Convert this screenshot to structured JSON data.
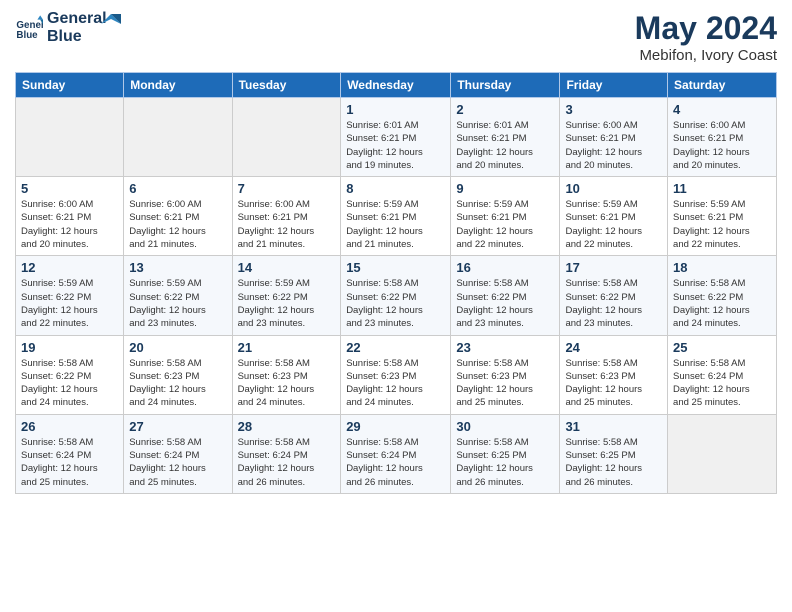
{
  "logo": {
    "line1": "General",
    "line2": "Blue"
  },
  "title": "May 2024",
  "subtitle": "Mebifon, Ivory Coast",
  "weekdays": [
    "Sunday",
    "Monday",
    "Tuesday",
    "Wednesday",
    "Thursday",
    "Friday",
    "Saturday"
  ],
  "weeks": [
    [
      {
        "day": "",
        "info": ""
      },
      {
        "day": "",
        "info": ""
      },
      {
        "day": "",
        "info": ""
      },
      {
        "day": "1",
        "info": "Sunrise: 6:01 AM\nSunset: 6:21 PM\nDaylight: 12 hours\nand 19 minutes."
      },
      {
        "day": "2",
        "info": "Sunrise: 6:01 AM\nSunset: 6:21 PM\nDaylight: 12 hours\nand 20 minutes."
      },
      {
        "day": "3",
        "info": "Sunrise: 6:00 AM\nSunset: 6:21 PM\nDaylight: 12 hours\nand 20 minutes."
      },
      {
        "day": "4",
        "info": "Sunrise: 6:00 AM\nSunset: 6:21 PM\nDaylight: 12 hours\nand 20 minutes."
      }
    ],
    [
      {
        "day": "5",
        "info": "Sunrise: 6:00 AM\nSunset: 6:21 PM\nDaylight: 12 hours\nand 20 minutes."
      },
      {
        "day": "6",
        "info": "Sunrise: 6:00 AM\nSunset: 6:21 PM\nDaylight: 12 hours\nand 21 minutes."
      },
      {
        "day": "7",
        "info": "Sunrise: 6:00 AM\nSunset: 6:21 PM\nDaylight: 12 hours\nand 21 minutes."
      },
      {
        "day": "8",
        "info": "Sunrise: 5:59 AM\nSunset: 6:21 PM\nDaylight: 12 hours\nand 21 minutes."
      },
      {
        "day": "9",
        "info": "Sunrise: 5:59 AM\nSunset: 6:21 PM\nDaylight: 12 hours\nand 22 minutes."
      },
      {
        "day": "10",
        "info": "Sunrise: 5:59 AM\nSunset: 6:21 PM\nDaylight: 12 hours\nand 22 minutes."
      },
      {
        "day": "11",
        "info": "Sunrise: 5:59 AM\nSunset: 6:21 PM\nDaylight: 12 hours\nand 22 minutes."
      }
    ],
    [
      {
        "day": "12",
        "info": "Sunrise: 5:59 AM\nSunset: 6:22 PM\nDaylight: 12 hours\nand 22 minutes."
      },
      {
        "day": "13",
        "info": "Sunrise: 5:59 AM\nSunset: 6:22 PM\nDaylight: 12 hours\nand 23 minutes."
      },
      {
        "day": "14",
        "info": "Sunrise: 5:59 AM\nSunset: 6:22 PM\nDaylight: 12 hours\nand 23 minutes."
      },
      {
        "day": "15",
        "info": "Sunrise: 5:58 AM\nSunset: 6:22 PM\nDaylight: 12 hours\nand 23 minutes."
      },
      {
        "day": "16",
        "info": "Sunrise: 5:58 AM\nSunset: 6:22 PM\nDaylight: 12 hours\nand 23 minutes."
      },
      {
        "day": "17",
        "info": "Sunrise: 5:58 AM\nSunset: 6:22 PM\nDaylight: 12 hours\nand 23 minutes."
      },
      {
        "day": "18",
        "info": "Sunrise: 5:58 AM\nSunset: 6:22 PM\nDaylight: 12 hours\nand 24 minutes."
      }
    ],
    [
      {
        "day": "19",
        "info": "Sunrise: 5:58 AM\nSunset: 6:22 PM\nDaylight: 12 hours\nand 24 minutes."
      },
      {
        "day": "20",
        "info": "Sunrise: 5:58 AM\nSunset: 6:23 PM\nDaylight: 12 hours\nand 24 minutes."
      },
      {
        "day": "21",
        "info": "Sunrise: 5:58 AM\nSunset: 6:23 PM\nDaylight: 12 hours\nand 24 minutes."
      },
      {
        "day": "22",
        "info": "Sunrise: 5:58 AM\nSunset: 6:23 PM\nDaylight: 12 hours\nand 24 minutes."
      },
      {
        "day": "23",
        "info": "Sunrise: 5:58 AM\nSunset: 6:23 PM\nDaylight: 12 hours\nand 25 minutes."
      },
      {
        "day": "24",
        "info": "Sunrise: 5:58 AM\nSunset: 6:23 PM\nDaylight: 12 hours\nand 25 minutes."
      },
      {
        "day": "25",
        "info": "Sunrise: 5:58 AM\nSunset: 6:24 PM\nDaylight: 12 hours\nand 25 minutes."
      }
    ],
    [
      {
        "day": "26",
        "info": "Sunrise: 5:58 AM\nSunset: 6:24 PM\nDaylight: 12 hours\nand 25 minutes."
      },
      {
        "day": "27",
        "info": "Sunrise: 5:58 AM\nSunset: 6:24 PM\nDaylight: 12 hours\nand 25 minutes."
      },
      {
        "day": "28",
        "info": "Sunrise: 5:58 AM\nSunset: 6:24 PM\nDaylight: 12 hours\nand 26 minutes."
      },
      {
        "day": "29",
        "info": "Sunrise: 5:58 AM\nSunset: 6:24 PM\nDaylight: 12 hours\nand 26 minutes."
      },
      {
        "day": "30",
        "info": "Sunrise: 5:58 AM\nSunset: 6:25 PM\nDaylight: 12 hours\nand 26 minutes."
      },
      {
        "day": "31",
        "info": "Sunrise: 5:58 AM\nSunset: 6:25 PM\nDaylight: 12 hours\nand 26 minutes."
      },
      {
        "day": "",
        "info": ""
      }
    ]
  ]
}
